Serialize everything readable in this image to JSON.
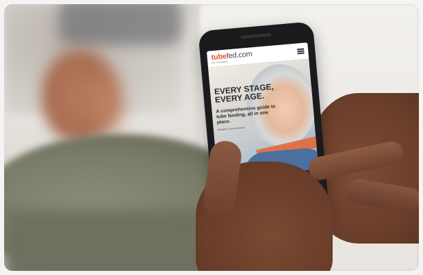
{
  "site": {
    "logo_tube": "tube",
    "logo_rest": "fed.com",
    "logo_sub": "BY AVANOS",
    "headline": "EVERY STAGE, EVERY AGE.",
    "subhead": "A comprehensive guide to tube feeding, all in one place.",
    "brought_by": "Brought to you by Avanos"
  },
  "icons": {
    "menu": "hamburger-icon",
    "help": "question-icon"
  },
  "colors": {
    "brand_orange": "#e4572e",
    "help_pink": "#c8456f",
    "dark_section": "#2c2c2e"
  }
}
